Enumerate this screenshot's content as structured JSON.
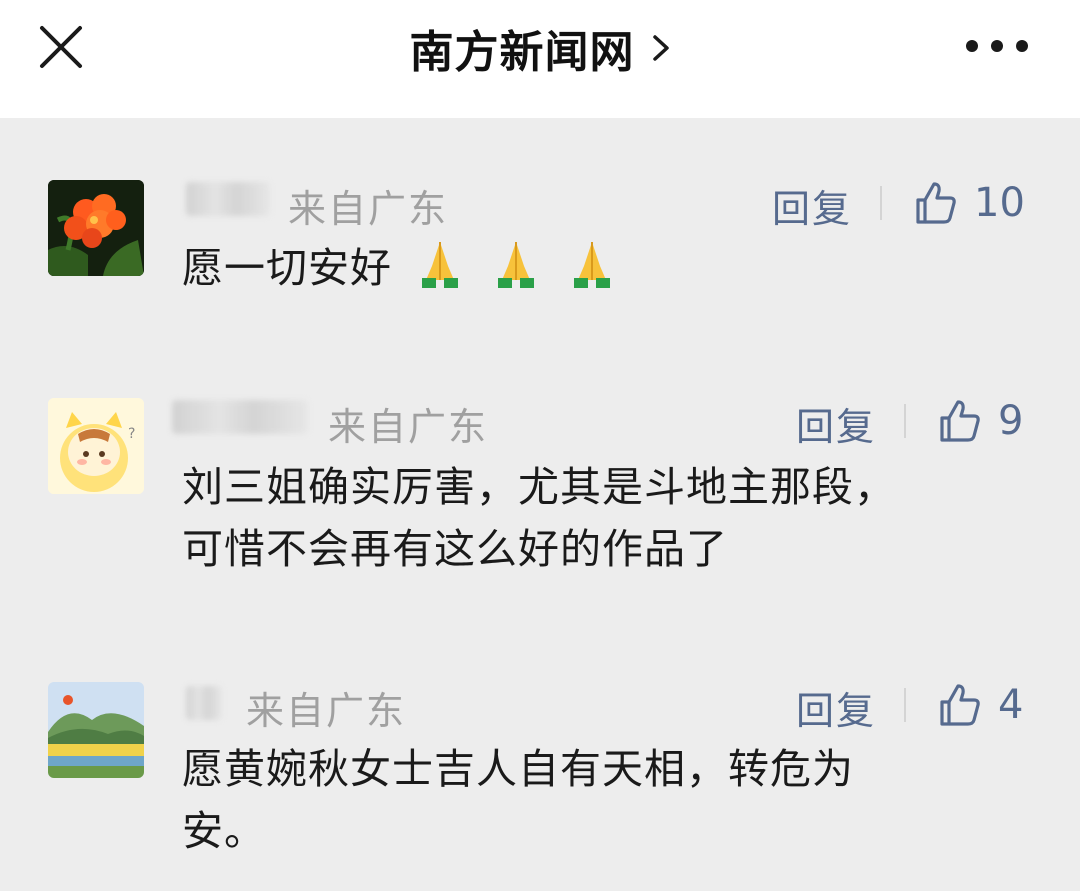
{
  "header": {
    "title": "南方新闻网",
    "close_icon": "close-icon",
    "chevron_icon": "chevron-right-icon",
    "more_icon": "more-horizontal-icon"
  },
  "comments": [
    {
      "from": "来自广东",
      "text": "愿一切安好",
      "emoji": "folded-hands",
      "emoji_count": 3,
      "reply_label": "回复",
      "likes": "10",
      "avatar": "flower-avatar"
    },
    {
      "from": "来自广东",
      "text_lines": [
        "刘三姐确实厉害，尤其是斗地主那段，",
        "可惜不会再有这么好的作品了"
      ],
      "reply_label": "回复",
      "likes": "9",
      "avatar": "cartoon-tiger-avatar"
    },
    {
      "from": "来自广东",
      "text_lines": [
        "愿黄婉秋女士吉人自有天相，转危为",
        "安。"
      ],
      "reply_label": "回复",
      "likes": "4",
      "avatar": "landscape-avatar"
    }
  ],
  "colors": {
    "background": "#ededed",
    "topbar": "#ffffff",
    "link": "#566a8e",
    "meta": "#a0a0a0"
  }
}
